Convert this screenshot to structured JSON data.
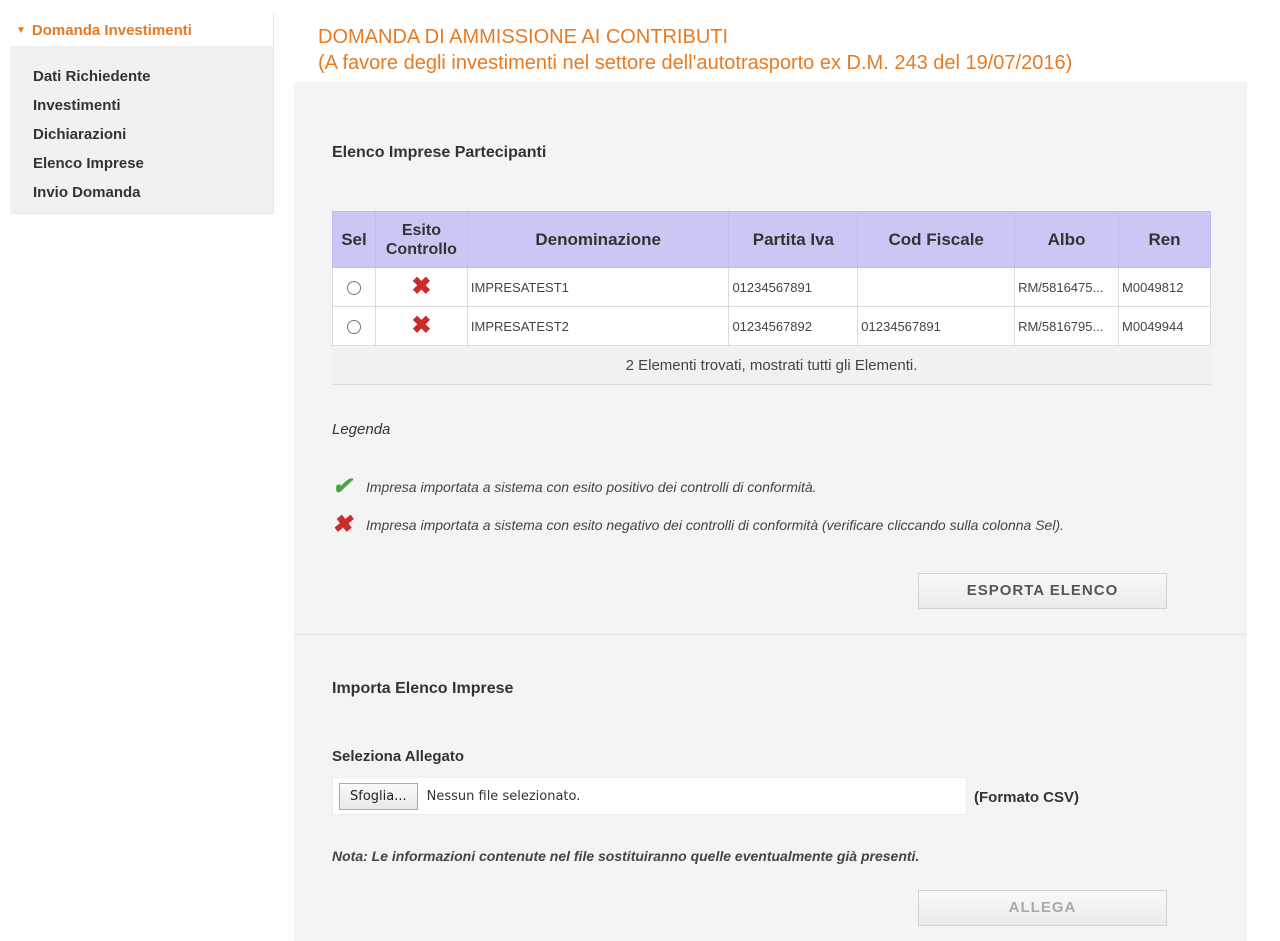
{
  "sidebar": {
    "title": "Domanda Investimenti",
    "items": [
      {
        "label": "Dati Richiedente"
      },
      {
        "label": "Investimenti"
      },
      {
        "label": "Dichiarazioni"
      },
      {
        "label": "Elenco Imprese"
      },
      {
        "label": "Invio Domanda"
      }
    ]
  },
  "header": {
    "line1": "DOMANDA DI AMMISSIONE AI CONTRIBUTI",
    "line2": "(A favore degli investimenti nel settore dell'autotrasporto ex D.M. 243 del 19/07/2016)"
  },
  "elenco": {
    "title": "Elenco Imprese Partecipanti",
    "columns": {
      "sel": "Sel",
      "esito_1": "Esito",
      "esito_2": "Controllo",
      "denominazione": "Denominazione",
      "partita_iva": "Partita Iva",
      "cod_fiscale": "Cod Fiscale",
      "albo": "Albo",
      "ren": "Ren"
    },
    "rows": [
      {
        "denominazione": "IMPRESATEST1",
        "partita_iva": "01234567891",
        "cod_fiscale": "",
        "albo": "RM/5816475...",
        "ren": "M0049812"
      },
      {
        "denominazione": "IMPRESATEST2",
        "partita_iva": "01234567892",
        "cod_fiscale": "01234567891",
        "albo": "RM/5816795...",
        "ren": "M0049944"
      }
    ],
    "footer": "2 Elementi trovati, mostrati tutti gli Elementi."
  },
  "legenda": {
    "title": "Legenda",
    "positive": "Impresa importata a sistema con esito positivo dei controlli di conformità.",
    "negative": "Impresa importata a sistema con esito negativo dei controlli di conformità (verificare cliccando sulla colonna Sel)."
  },
  "export_button": "ESPORTA ELENCO",
  "import": {
    "title": "Importa Elenco Imprese",
    "label": "Seleziona Allegato",
    "browse_label": "Sfoglia...",
    "no_file": "Nessun file selezionato.",
    "format": "(Formato CSV)",
    "note": "Nota: Le informazioni contenute nel file sostituiranno quelle eventualmente già presenti.",
    "attach_button": "ALLEGA"
  },
  "colors": {
    "accent": "#e87a24",
    "table_header": "#c9c8f5",
    "error": "#cc2b2b",
    "success": "#43a93a"
  },
  "icons": {
    "sidebar_caret": "caret-down-icon",
    "error": "red-x-icon",
    "success": "green-check-icon"
  }
}
